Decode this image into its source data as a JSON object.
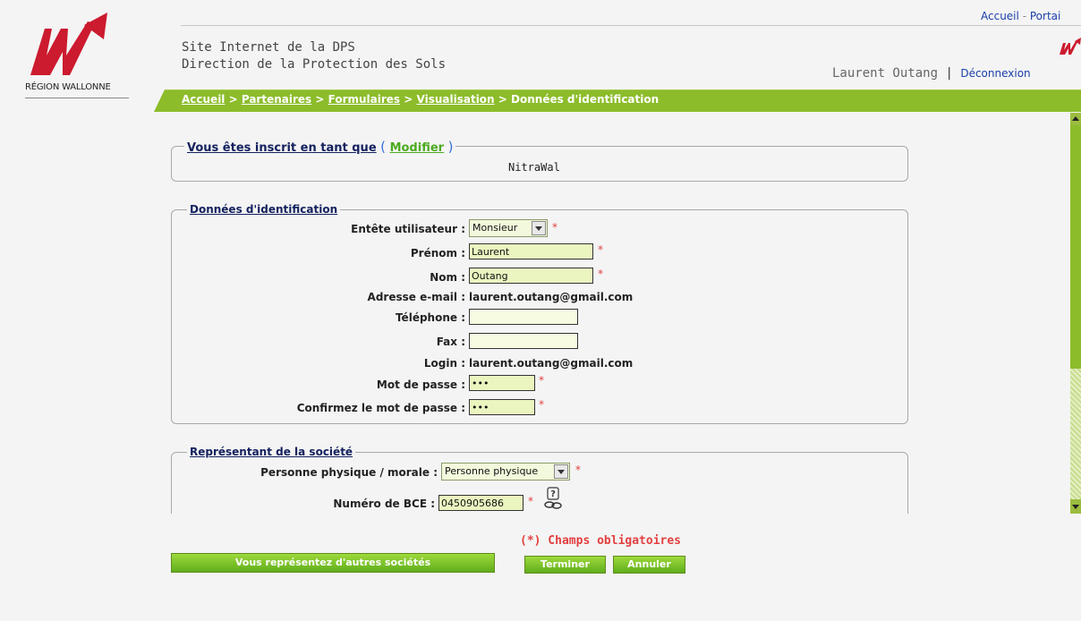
{
  "header": {
    "region_label": "RÉGION WALLONNE",
    "title_line1": "Site Internet de la DPS",
    "title_line2": "Direction de la Protection des Sols",
    "top_links": {
      "home": "Accueil",
      "separator": "-",
      "portal": "Portai"
    },
    "user_name": "Laurent Outang",
    "user_separator": "|",
    "logout": "Déconnexion",
    "brand_color": "#cc1a2e",
    "bar_color": "#8cbc2a"
  },
  "breadcrumb": {
    "items": [
      "Accueil",
      "Partenaires",
      "Formulaires",
      "Visualisation"
    ],
    "separator": ">",
    "current": "Données d'identification"
  },
  "inscription": {
    "legend": "Vous êtes inscrit en tant que",
    "open_paren": "(",
    "modify": "Modifier",
    "close_paren": ")",
    "value": "NitraWal"
  },
  "identification": {
    "legend": "Données d'identification",
    "entete_label": "Entête utilisateur :",
    "entete_value": "Monsieur",
    "prenom_label": "Prénom :",
    "prenom_value": "Laurent",
    "nom_label": "Nom :",
    "nom_value": "Outang",
    "email_label": "Adresse e-mail :",
    "email_value": "laurent.outang@gmail.com",
    "telephone_label": "Téléphone :",
    "telephone_value": "",
    "fax_label": "Fax :",
    "fax_value": "",
    "login_label": "Login :",
    "login_value": "laurent.outang@gmail.com",
    "password_label": "Mot de passe :",
    "password_value": "•••",
    "confirm_label": "Confirmez le mot de passe :",
    "confirm_value": "•••",
    "required_mark": "*"
  },
  "societe": {
    "legend": "Représentant de la société",
    "personne_label": "Personne physique / morale :",
    "personne_value": "Personne physique",
    "bce_label": "Numéro de BCE :",
    "bce_value": "0450905686",
    "help_icon": "help-chain-icon",
    "required_mark": "*"
  },
  "footer": {
    "required_note": "(*) Champs obligatoires",
    "other_companies": "Vous représentez d'autres sociétés",
    "finish": "Terminer",
    "cancel": "Annuler",
    "required_color": "#e24040"
  }
}
